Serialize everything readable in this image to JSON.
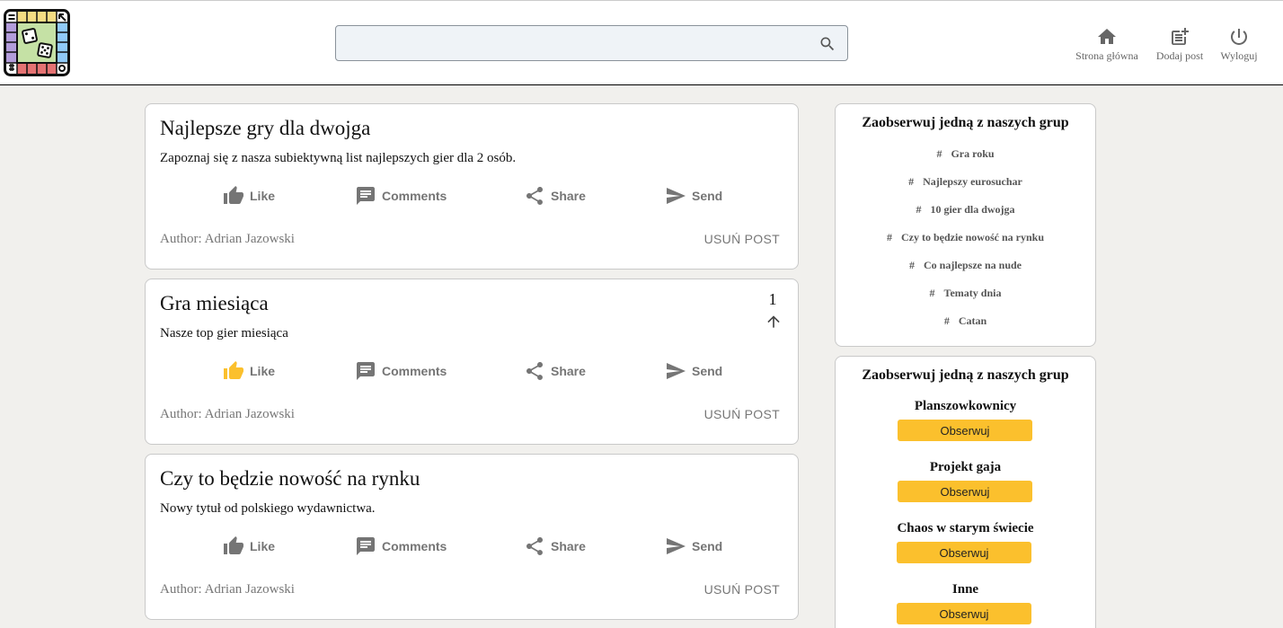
{
  "header": {
    "search": {
      "placeholder": ""
    },
    "nav": {
      "home": "Strona główna",
      "add_post": "Dodaj post",
      "logout": "Wyloguj"
    }
  },
  "actions": {
    "like": "Like",
    "comments": "Comments",
    "share": "Share",
    "send": "Send"
  },
  "posts": [
    {
      "title": "Najlepsze gry dla dwojga",
      "description": "Zapoznaj się z nasza subiektywną list najlepszych gier dla 2 osób.",
      "author": "Author: Adrian Jazowski",
      "delete_label": "USUŃ POST",
      "votes": "",
      "liked": false
    },
    {
      "title": "Gra miesiąca",
      "description": "Nasze top gier miesiąca",
      "author": "Author: Adrian Jazowski",
      "delete_label": "USUŃ POST",
      "votes": "1",
      "liked": true
    },
    {
      "title": "Czy to będzie nowość na rynku",
      "description": "Nowy tytuł od polskiego wydawnictwa.",
      "author": "Author: Adrian Jazowski",
      "delete_label": "USUŃ POST",
      "votes": "",
      "liked": false
    }
  ],
  "sidebar": {
    "topics": {
      "heading": "Zaobserwuj jedną z naszych grup",
      "hash": "#",
      "items": [
        "Gra roku",
        "Najlepszy eurosuchar",
        "10 gier dla dwojga",
        "Czy to będzie nowość na rynku",
        "Co najlepsze na nude",
        "Tematy dnia",
        "Catan"
      ]
    },
    "groups": {
      "heading": "Zaobserwuj jedną z naszych grup",
      "follow_label": "Obserwuj",
      "items": [
        "Planszowkownicy",
        "Projekt gaja",
        "Chaos w starym świecie",
        "Inne"
      ]
    }
  },
  "colors": {
    "accent": "#fbc02d",
    "icon_gray": "#757575",
    "background": "#f1f0ed"
  },
  "icons": {
    "logo": "board-game-logo",
    "search": "search-icon",
    "home": "home-icon",
    "add_post": "post-add-icon",
    "logout": "power-icon",
    "like": "thumb-up-icon",
    "comments": "comment-icon",
    "share": "share-icon",
    "send": "send-icon",
    "upvote": "arrow-up-icon"
  }
}
